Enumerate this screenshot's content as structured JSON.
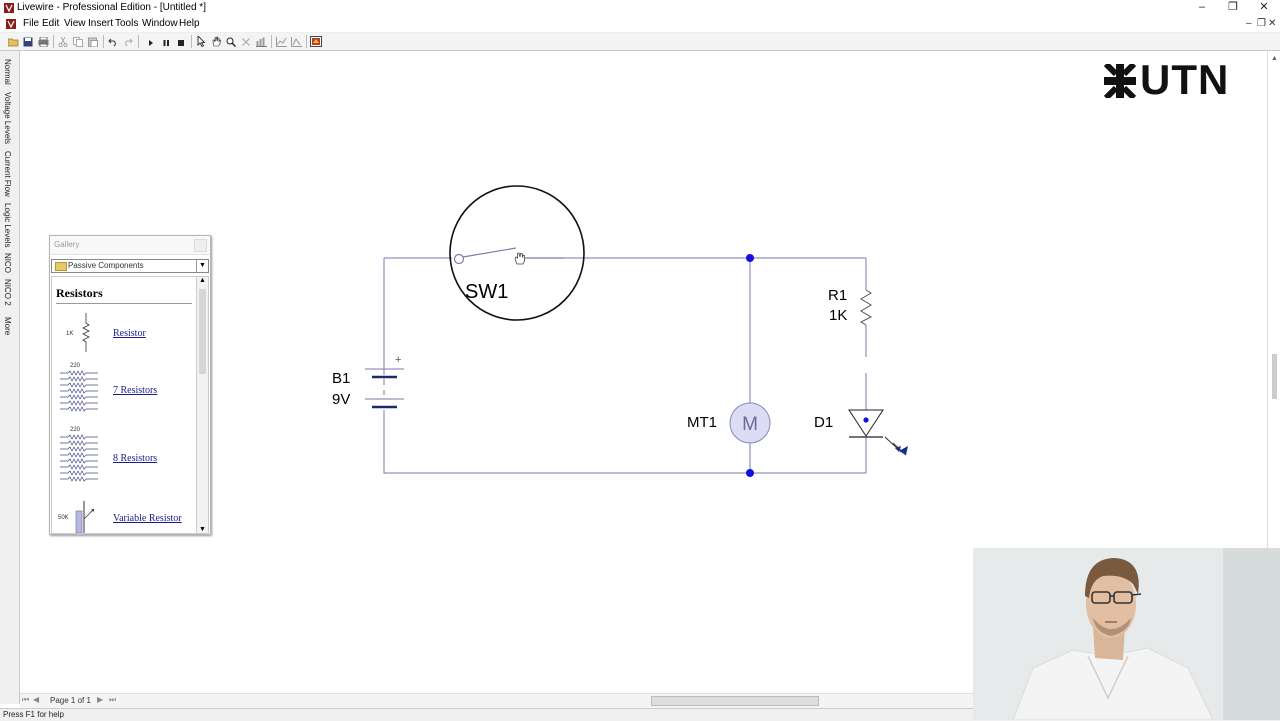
{
  "window": {
    "title": "Livewire - Professional Edition - [Untitled *]",
    "controls": [
      "–",
      "❐",
      "✕"
    ]
  },
  "menu": {
    "items": [
      "File",
      "Edit",
      "View",
      "Insert",
      "Tools",
      "Window",
      "Help"
    ],
    "mdi_controls": [
      "–",
      "❐",
      "✕"
    ]
  },
  "toolbar": {
    "icons": [
      "open-icon",
      "save-icon",
      "print-icon",
      "cut-icon",
      "copy-icon",
      "paste-icon",
      "undo-icon",
      "redo-icon",
      "play-icon",
      "pause-icon",
      "stop-icon",
      "select-icon",
      "pan-icon",
      "zoom-icon",
      "delete-icon",
      "chart-icon",
      "graph-icon",
      "probe-icon",
      "gallery-icon"
    ]
  },
  "side_tabs": [
    "Normal",
    "Voltage Levels",
    "Current Flow",
    "Logic Levels",
    "NICO",
    "NICO 2",
    "More"
  ],
  "logo": {
    "text": "UTN"
  },
  "gallery": {
    "title": "Gallery",
    "category": "Passive Components",
    "section_title": "Resistors",
    "items": [
      {
        "label": "Resistor",
        "thumb_text": "1K"
      },
      {
        "label": "7 Resistors",
        "thumb_text": "220"
      },
      {
        "label": "8 Resistors",
        "thumb_text": "220"
      },
      {
        "label": "Variable Resistor",
        "thumb_text": "50K"
      }
    ]
  },
  "circuit": {
    "components": {
      "switch": {
        "name": "SW1"
      },
      "battery": {
        "name": "B1",
        "value": "9V",
        "polarity": "+"
      },
      "resistor": {
        "name": "R1",
        "value": "1K"
      },
      "motor": {
        "name": "MT1",
        "symbol": "M"
      },
      "led": {
        "name": "D1"
      }
    },
    "wire_color": "#7a7ab0",
    "node_color": "#1010e0"
  },
  "pager": {
    "page_label": "Page 1 of 1",
    "nav": [
      "⏮",
      "◀",
      "▶",
      "⏭"
    ]
  },
  "status": {
    "text": "Press F1 for help"
  }
}
